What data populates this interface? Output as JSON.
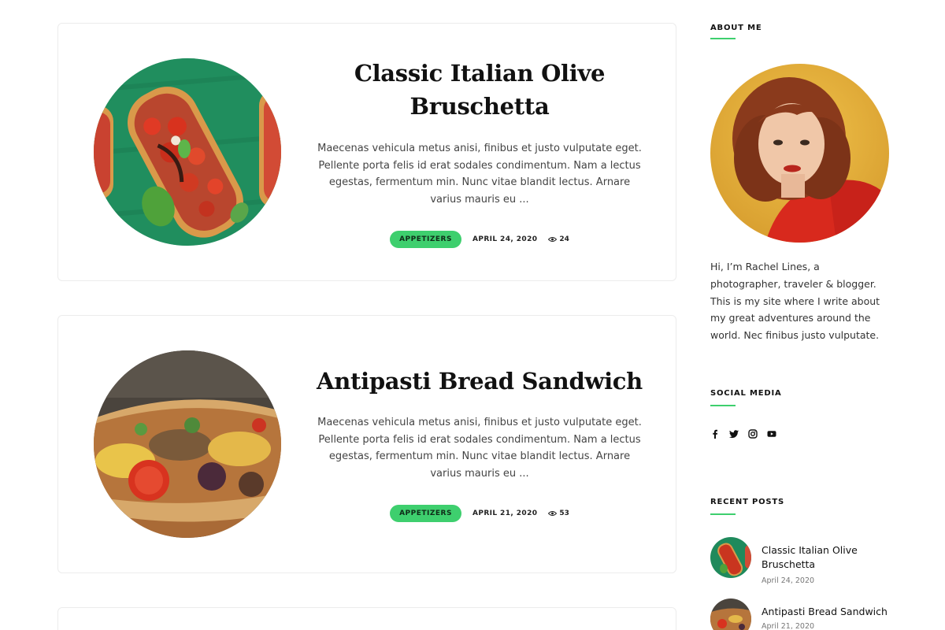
{
  "posts": [
    {
      "title": "Classic Italian Olive Bruschetta",
      "excerpt": "Maecenas vehicula metus anisi, finibus et justo vulputate eget. Pellente porta felis id erat sodales condimentum. Nam a lectus egestas, fermentum min. Nunc vitae blandit lectus. Arnare varius mauris eu ...",
      "category": "APPETIZERS",
      "date": "APRIL 24, 2020",
      "views": "24",
      "image_icon": "bruschetta-photo"
    },
    {
      "title": "Antipasti Bread Sandwich",
      "excerpt": "Maecenas vehicula metus anisi, finibus et justo vulputate eget. Pellente porta felis id erat sodales condimentum. Nam a lectus egestas, fermentum min. Nunc vitae blandit lectus. Arnare varius mauris eu ...",
      "category": "APPETIZERS",
      "date": "APRIL 21, 2020",
      "views": "53",
      "image_icon": "sandwich-photo"
    }
  ],
  "sidebar": {
    "about": {
      "title": "ABOUT ME",
      "bio": "Hi, I’m Rachel Lines, a photographer, traveler & blogger. This is my site where I write about my great adventures around the world. Nec finibus justo vulputate."
    },
    "social": {
      "title": "SOCIAL MEDIA",
      "icons": [
        "facebook-icon",
        "twitter-icon",
        "instagram-icon",
        "youtube-icon"
      ]
    },
    "recent": {
      "title": "RECENT POSTS",
      "items": [
        {
          "title": "Classic Italian Olive Bruschetta",
          "date": "April 24, 2020"
        },
        {
          "title": "Antipasti Bread Sandwich",
          "date": "April 21, 2020"
        }
      ]
    }
  },
  "colors": {
    "accent": "#3ecf6e",
    "border": "#ececec",
    "heading": "#111111",
    "text": "#444444"
  }
}
